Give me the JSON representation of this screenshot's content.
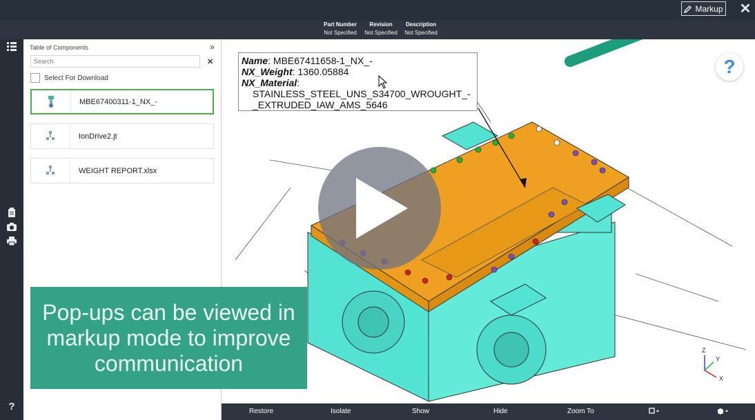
{
  "toolbar": {
    "markup_label": "Markup",
    "markup_icon": "pencil-icon",
    "close_icon": "close-icon"
  },
  "header_meta": [
    {
      "heading": "Part Number",
      "value": "Not Specified"
    },
    {
      "heading": "Revision",
      "value": "Not Specified"
    },
    {
      "heading": "Description",
      "value": "Not Specified"
    }
  ],
  "left_rail": {
    "top_icon": "list-icon",
    "icons": [
      "clipboard-icon",
      "camera-icon",
      "print-icon"
    ],
    "help_label": "?"
  },
  "panel": {
    "title": "Table of Components",
    "search_placeholder": "Search",
    "select_for_download": "Select For Download",
    "items": [
      {
        "label": "MBE67400311-1_NX_-",
        "selected": true
      },
      {
        "label": "IonDrive2.jt",
        "selected": false
      },
      {
        "label": "WEIGHT REPORT.xlsx",
        "selected": false
      }
    ]
  },
  "popup": {
    "name_key": "Name",
    "name_value": ": MBE67411658-1_NX_-",
    "weight_key": "NX_Weight",
    "weight_value": ": 1360.05884",
    "material_key": "NX_Material",
    "material_value": ":",
    "material_line1": "STAINLESS_STEEL_UNS_S34700_WROUGHT_-",
    "material_line2": "_EXTRUDED_IAW_AMS_5646"
  },
  "help_button": "?",
  "caption": "Pop-ups can be viewed in markup mode to improve communication",
  "bottom_bar": [
    "Restore",
    "Isolate",
    "Show",
    "Hide",
    "Zoom To"
  ],
  "axes": {
    "x": "X",
    "y": "Y",
    "z": "Z"
  },
  "colors": {
    "accent_green": "#4cae4c",
    "caption_teal": "#2a9e80",
    "part_orange": "#f0a020",
    "part_cyan": "#4fe0d0",
    "arrow_teal": "#1c9e7e"
  }
}
